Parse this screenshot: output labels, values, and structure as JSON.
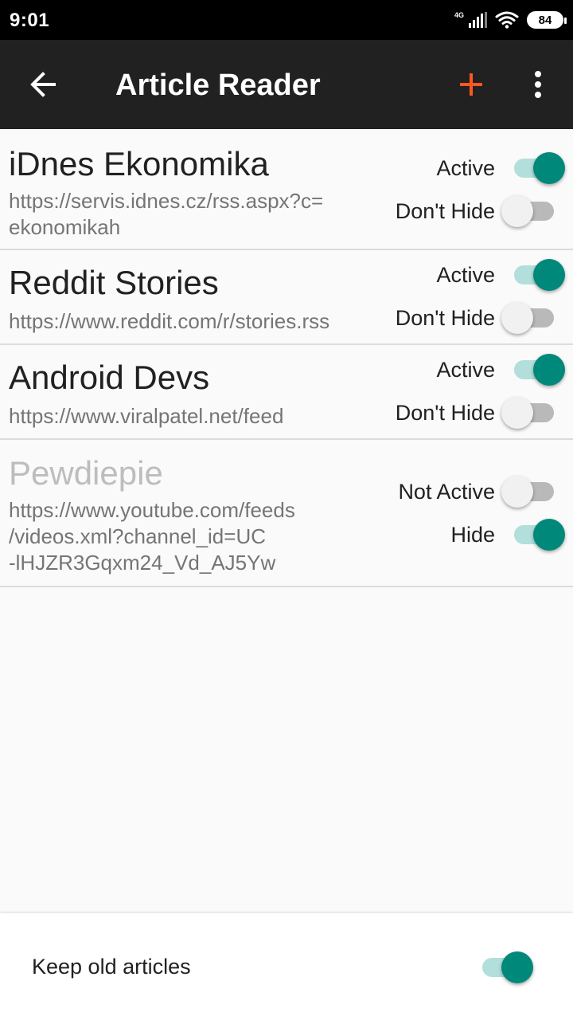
{
  "status_bar": {
    "time": "9:01",
    "network": "4G",
    "battery": "84",
    "icons": [
      "signal-icon",
      "wifi-icon",
      "battery-icon"
    ]
  },
  "app_bar": {
    "title": "Article Reader",
    "back_icon": "arrow-left-icon",
    "add_icon": "plus-icon",
    "more_icon": "more-vert-icon",
    "accent_color": "#ff5722"
  },
  "feeds": [
    {
      "name": "iDnes Ekonomika",
      "url_lines": [
        "https://servis.idnes.cz/rss.aspx?c=",
        "ekonomikah"
      ],
      "active_label": "Active",
      "active": true,
      "hide_label": "Don't Hide",
      "hide": false
    },
    {
      "name": "Reddit Stories",
      "url_lines": [
        "https://www.reddit.com/r/stories.rss"
      ],
      "active_label": "Active",
      "active": true,
      "hide_label": "Don't Hide",
      "hide": false
    },
    {
      "name": "Android Devs",
      "url_lines": [
        "https://www.viralpatel.net/feed"
      ],
      "active_label": "Active",
      "active": true,
      "hide_label": "Don't Hide",
      "hide": false
    },
    {
      "name": "Pewdiepie",
      "url_lines": [
        "https://www.youtube.com/feeds",
        "/videos.xml?channel_id=UC",
        "-lHJZR3Gqxm24_Vd_AJ5Yw"
      ],
      "active_label": "Not Active",
      "active": false,
      "hide_label": "Hide",
      "hide": true
    }
  ],
  "bottom": {
    "keep_old_label": "Keep old articles",
    "keep_old": true
  },
  "colors": {
    "switch_on_thumb": "#00897b",
    "switch_on_track": "#b2dfdb",
    "app_bar": "#212121"
  }
}
